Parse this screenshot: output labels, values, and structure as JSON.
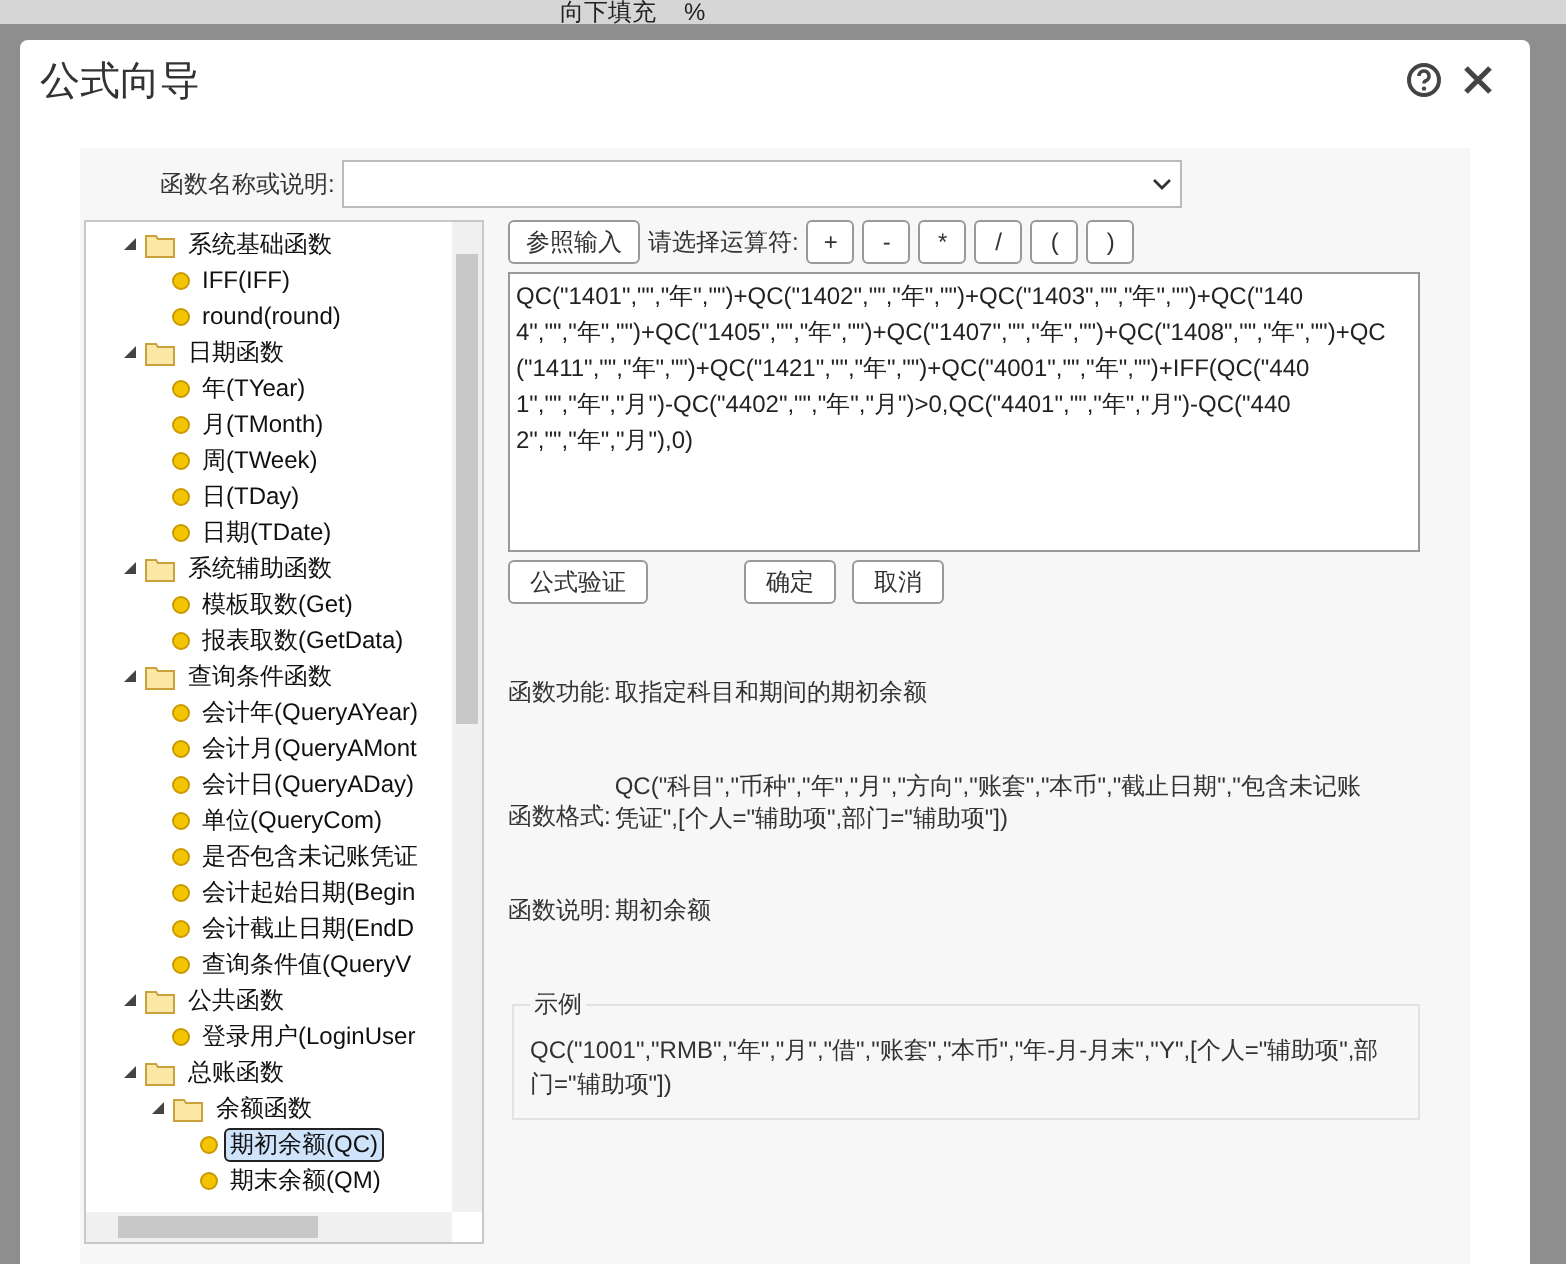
{
  "toolbar": {
    "fill_label": "向下填充",
    "percent": "%"
  },
  "dialog": {
    "title": "公式向导"
  },
  "search": {
    "label": "函数名称或说明:"
  },
  "tree": [
    {
      "label": "系统基础函数",
      "kind": "folder",
      "expanded": true,
      "selected": false,
      "children": [
        {
          "label": "IFF(IFF)",
          "kind": "leaf",
          "selected": false
        },
        {
          "label": "round(round)",
          "kind": "leaf",
          "selected": false
        }
      ]
    },
    {
      "label": "日期函数",
      "kind": "folder",
      "expanded": true,
      "selected": false,
      "children": [
        {
          "label": "年(TYear)",
          "kind": "leaf",
          "selected": false
        },
        {
          "label": "月(TMonth)",
          "kind": "leaf",
          "selected": false
        },
        {
          "label": "周(TWeek)",
          "kind": "leaf",
          "selected": false
        },
        {
          "label": "日(TDay)",
          "kind": "leaf",
          "selected": false
        },
        {
          "label": "日期(TDate)",
          "kind": "leaf",
          "selected": false
        }
      ]
    },
    {
      "label": "系统辅助函数",
      "kind": "folder",
      "expanded": true,
      "selected": false,
      "children": [
        {
          "label": "模板取数(Get)",
          "kind": "leaf",
          "selected": false
        },
        {
          "label": "报表取数(GetData)",
          "kind": "leaf",
          "selected": false
        }
      ]
    },
    {
      "label": "查询条件函数",
      "kind": "folder",
      "expanded": true,
      "selected": false,
      "children": [
        {
          "label": "会计年(QueryAYear)",
          "kind": "leaf",
          "selected": false
        },
        {
          "label": "会计月(QueryAMont",
          "kind": "leaf",
          "selected": false
        },
        {
          "label": "会计日(QueryADay)",
          "kind": "leaf",
          "selected": false
        },
        {
          "label": "单位(QueryCom)",
          "kind": "leaf",
          "selected": false
        },
        {
          "label": "是否包含未记账凭证",
          "kind": "leaf",
          "selected": false
        },
        {
          "label": "会计起始日期(Begin",
          "kind": "leaf",
          "selected": false
        },
        {
          "label": "会计截止日期(EndD",
          "kind": "leaf",
          "selected": false
        },
        {
          "label": "查询条件值(QueryV",
          "kind": "leaf",
          "selected": false
        }
      ]
    },
    {
      "label": "公共函数",
      "kind": "folder",
      "expanded": true,
      "selected": false,
      "children": [
        {
          "label": "登录用户(LoginUser",
          "kind": "leaf",
          "selected": false
        }
      ]
    },
    {
      "label": "总账函数",
      "kind": "folder",
      "expanded": true,
      "selected": false,
      "children": [
        {
          "label": "余额函数",
          "kind": "folder",
          "expanded": true,
          "selected": false,
          "children": [
            {
              "label": "期初余额(QC)",
              "kind": "leaf",
              "selected": true
            },
            {
              "label": "期末余额(QM)",
              "kind": "leaf",
              "selected": false
            }
          ]
        }
      ]
    }
  ],
  "ref_button": "参照输入",
  "operator_label": "请选择运算符:",
  "operators": [
    "+",
    "-",
    "*",
    "/",
    "(",
    ")"
  ],
  "formula": "QC(\"1401\",\"\",\"年\",\"\")+QC(\"1402\",\"\",\"年\",\"\")+QC(\"1403\",\"\",\"年\",\"\")+QC(\"1404\",\"\",\"年\",\"\")+QC(\"1405\",\"\",\"年\",\"\")+QC(\"1407\",\"\",\"年\",\"\")+QC(\"1408\",\"\",\"年\",\"\")+QC(\"1411\",\"\",\"年\",\"\")+QC(\"1421\",\"\",\"年\",\"\")+QC(\"4001\",\"\",\"年\",\"\")+IFF(QC(\"4401\",\"\",\"年\",\"月\")-QC(\"4402\",\"\",\"年\",\"月\")>0,QC(\"4401\",\"\",\"年\",\"月\")-QC(\"4402\",\"\",\"年\",\"月\"),0)",
  "actions": [
    "公式验证",
    "确定",
    "取消"
  ],
  "info": [
    {
      "label": "函数功能:",
      "text": "取指定科目和期间的期初余额"
    },
    {
      "label": "函数格式:",
      "text": "QC(\"科目\",\"币种\",\"年\",\"月\",\"方向\",\"账套\",\"本币\",\"截止日期\",\"包含未记账凭证\",[个人=\"辅助项\",部门=\"辅助项\"])"
    },
    {
      "label": "函数说明:",
      "text": "期初余额"
    }
  ],
  "example": {
    "legend": "示例",
    "text": "QC(\"1001\",\"RMB\",\"年\",\"月\",\"借\",\"账套\",\"本币\",\"年-月-月末\",\"Y\",[个人=\"辅助项\",部门=\"辅助项\"])"
  }
}
